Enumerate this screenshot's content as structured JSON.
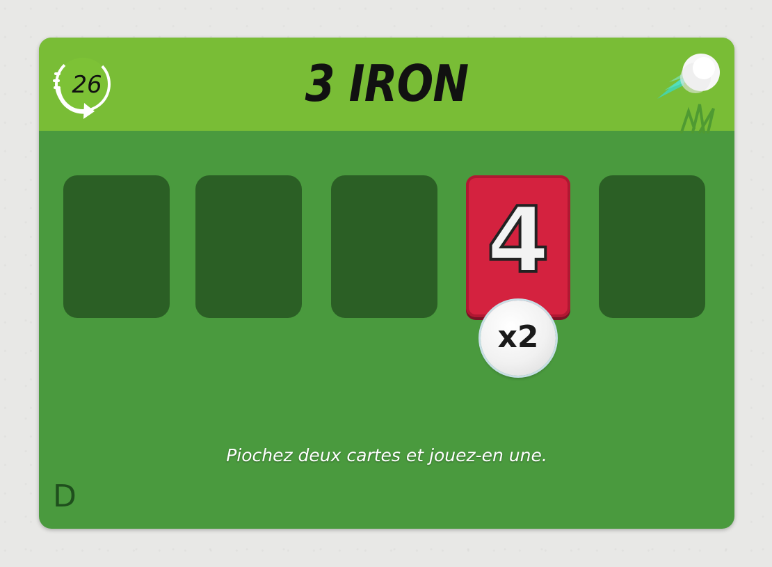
{
  "card": {
    "title": "3 IRON",
    "counter": "26",
    "played_card_value": "4",
    "multiplier": "x2",
    "instruction": "Piochez deux cartes et jouez-en une.",
    "corner_letter": "D",
    "empty_slots": 4,
    "icons": {
      "counter": "refresh-arrow-icon",
      "ball": "golf-ball-icon"
    },
    "colors": {
      "header": "#79bd36",
      "body": "#4a9a3e",
      "slot": "#2b5f25",
      "played_card": "#d4223f"
    }
  }
}
